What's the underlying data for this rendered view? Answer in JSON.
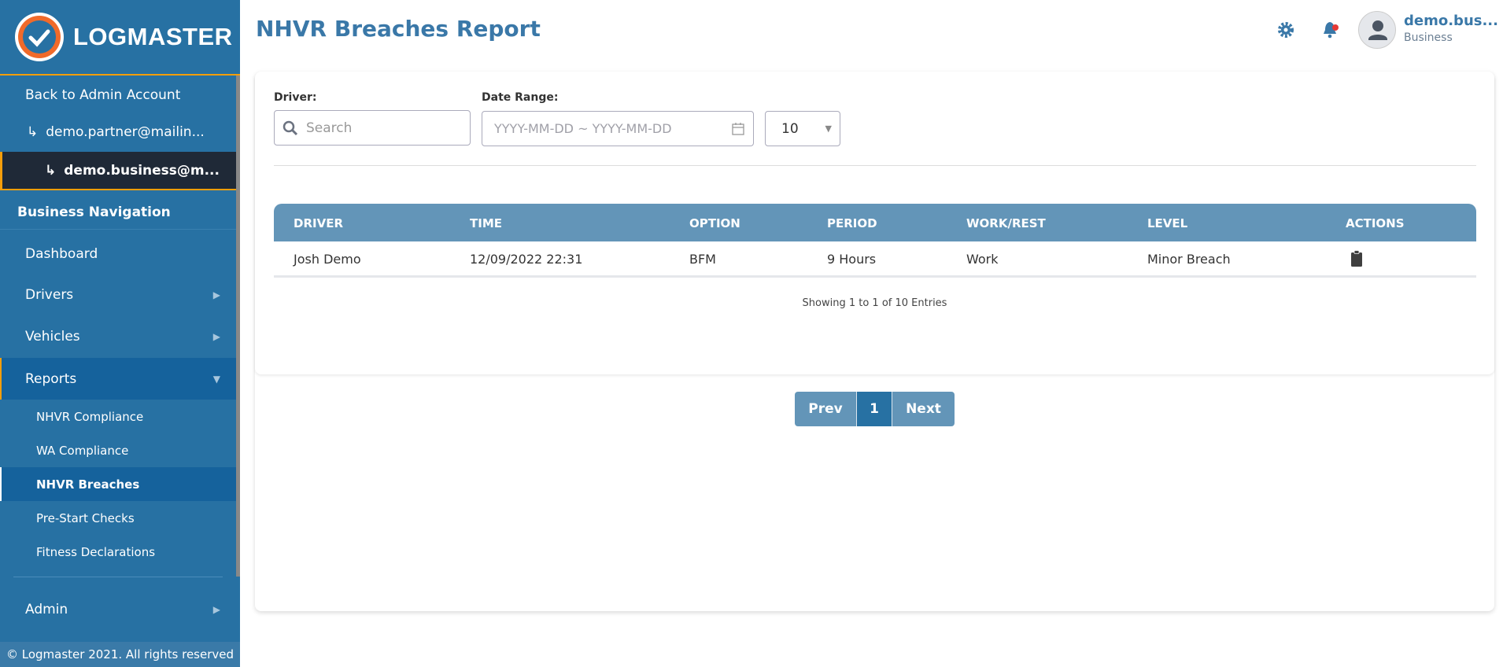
{
  "brand": {
    "name": "LOGMASTER"
  },
  "sidebar": {
    "back": "Back to Admin Account",
    "partner": "demo.partner@mailin...",
    "business": "demo.business@m...",
    "section": "Business Navigation",
    "items": [
      {
        "label": "Dashboard"
      },
      {
        "label": "Drivers"
      },
      {
        "label": "Vehicles"
      },
      {
        "label": "Reports"
      }
    ],
    "reports_sub": [
      {
        "label": "NHVR Compliance"
      },
      {
        "label": "WA Compliance"
      },
      {
        "label": "NHVR Breaches"
      },
      {
        "label": "Pre-Start Checks"
      },
      {
        "label": "Fitness Declarations"
      }
    ],
    "admin": "Admin",
    "footer": "© Logmaster 2021. All rights reserved",
    "arrow": "↳"
  },
  "header": {
    "title": "NHVR Breaches Report",
    "user_name": "demo.bus...",
    "user_role": "Business"
  },
  "filters": {
    "driver_label": "Driver:",
    "driver_placeholder": "Search",
    "date_label": "Date Range:",
    "date_placeholder": "YYYY-MM-DD ~ YYYY-MM-DD",
    "page_size": "10"
  },
  "table": {
    "headers": [
      "DRIVER",
      "TIME",
      "OPTION",
      "PERIOD",
      "WORK/REST",
      "LEVEL",
      "ACTIONS"
    ],
    "rows": [
      [
        "Josh Demo",
        "12/09/2022 22:31",
        "BFM",
        "9 Hours",
        "Work",
        "Minor Breach"
      ]
    ]
  },
  "pagination": {
    "info": "Showing 1 to 1 of 10 Entries",
    "prev": "Prev",
    "current": "1",
    "next": "Next"
  },
  "colors": {
    "sidebar": "#2771a3",
    "active": "#15629c",
    "accent": "#f59e0b",
    "table_header": "#6395b8"
  }
}
